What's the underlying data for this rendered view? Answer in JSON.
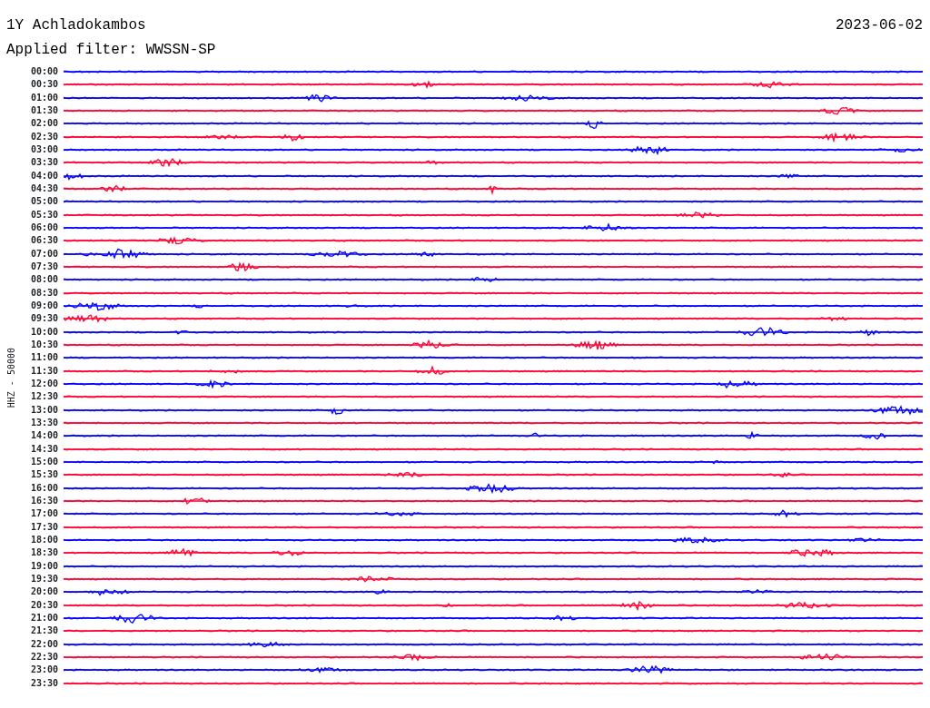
{
  "header": {
    "station": "1Y Achladokambos",
    "date": "2023-06-02",
    "filter": "Applied filter: WWSSN-SP"
  },
  "axis_label": "HHZ - 50000",
  "rows": [
    {
      "time": "00:00",
      "color": "#0000ff"
    },
    {
      "time": "00:30",
      "color": "#ff0033"
    },
    {
      "time": "01:00",
      "color": "#0000ff"
    },
    {
      "time": "01:30",
      "color": "#ff0033"
    },
    {
      "time": "02:00",
      "color": "#0000ff"
    },
    {
      "time": "02:30",
      "color": "#ff0033"
    },
    {
      "time": "03:00",
      "color": "#0000ff"
    },
    {
      "time": "03:30",
      "color": "#ff0033"
    },
    {
      "time": "04:00",
      "color": "#0000ff"
    },
    {
      "time": "04:30",
      "color": "#ff0033"
    },
    {
      "time": "05:00",
      "color": "#0000ff"
    },
    {
      "time": "05:30",
      "color": "#ff0033"
    },
    {
      "time": "06:00",
      "color": "#0000ff"
    },
    {
      "time": "06:30",
      "color": "#ff0033"
    },
    {
      "time": "07:00",
      "color": "#0000ff"
    },
    {
      "time": "07:30",
      "color": "#ff0033"
    },
    {
      "time": "08:00",
      "color": "#0000ff"
    },
    {
      "time": "08:30",
      "color": "#ff0033"
    },
    {
      "time": "09:00",
      "color": "#0000ff"
    },
    {
      "time": "09:30",
      "color": "#ff0033"
    },
    {
      "time": "10:00",
      "color": "#0000ff"
    },
    {
      "time": "10:30",
      "color": "#ff0033"
    },
    {
      "time": "11:00",
      "color": "#0000ff"
    },
    {
      "time": "11:30",
      "color": "#ff0033"
    },
    {
      "time": "12:00",
      "color": "#0000ff"
    },
    {
      "time": "12:30",
      "color": "#ff0033"
    },
    {
      "time": "13:00",
      "color": "#0000ff"
    },
    {
      "time": "13:30",
      "color": "#ff0033"
    },
    {
      "time": "14:00",
      "color": "#0000ff"
    },
    {
      "time": "14:30",
      "color": "#ff0033"
    },
    {
      "time": "15:00",
      "color": "#0000ff"
    },
    {
      "time": "15:30",
      "color": "#ff0033"
    },
    {
      "time": "16:00",
      "color": "#0000ff"
    },
    {
      "time": "16:30",
      "color": "#ff0033"
    },
    {
      "time": "17:00",
      "color": "#0000ff"
    },
    {
      "time": "17:30",
      "color": "#ff0033"
    },
    {
      "time": "18:00",
      "color": "#0000ff"
    },
    {
      "time": "18:30",
      "color": "#ff0033"
    },
    {
      "time": "19:00",
      "color": "#0000ff"
    },
    {
      "time": "19:30",
      "color": "#ff0033"
    },
    {
      "time": "20:00",
      "color": "#0000ff"
    },
    {
      "time": "20:30",
      "color": "#ff0033"
    },
    {
      "time": "21:00",
      "color": "#0000ff"
    },
    {
      "time": "21:30",
      "color": "#ff0033"
    },
    {
      "time": "22:00",
      "color": "#0000ff"
    },
    {
      "time": "22:30",
      "color": "#ff0033"
    },
    {
      "time": "23:00",
      "color": "#0000ff"
    },
    {
      "time": "23:30",
      "color": "#ff0033"
    }
  ]
}
